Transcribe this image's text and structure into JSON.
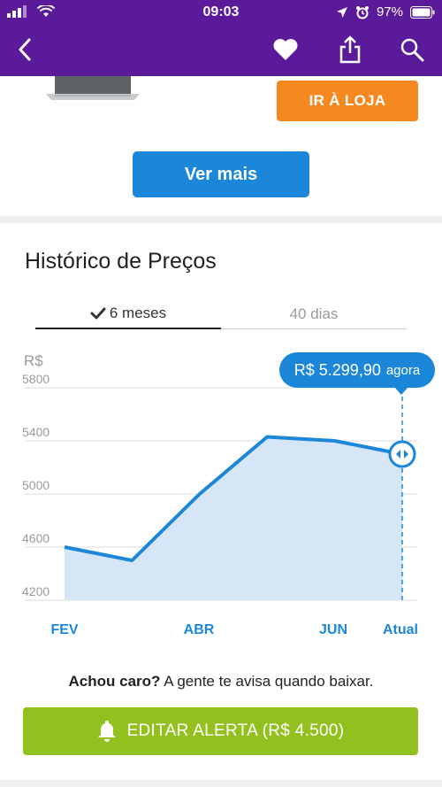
{
  "status_bar": {
    "time": "09:03",
    "battery": "97%"
  },
  "navbar": {
    "icons": [
      "back-icon",
      "heart-icon",
      "share-icon",
      "search-icon"
    ]
  },
  "product": {
    "store_button": "IR À LOJA",
    "more_button": "Ver mais"
  },
  "price_history": {
    "title": "Histórico de Preços",
    "tabs": [
      {
        "label": "6 meses",
        "active": true
      },
      {
        "label": "40 dias",
        "active": false
      }
    ],
    "current_price": "R$ 5.299,90",
    "current_suffix": "agora"
  },
  "chart_data": {
    "type": "area",
    "ylabel": "R$",
    "ylim": [
      4200,
      5800
    ],
    "yticks": [
      4200,
      4600,
      5000,
      5400,
      5800
    ],
    "xticks": [
      "FEV",
      "ABR",
      "JUN",
      "Atual"
    ],
    "x": [
      "FEV",
      "",
      "ABR",
      "",
      "JUN",
      "Atual"
    ],
    "values": [
      4600,
      4500,
      5000,
      5430,
      5400,
      5300
    ],
    "grid": true,
    "colors": {
      "line": "#1c87d8",
      "fill": "#d6e6f6",
      "label": "#1c87d8",
      "tick": "#999999"
    }
  },
  "alert": {
    "question": "Achou caro?",
    "text": " A gente te avisa quando baixar.",
    "button_label": "EDITAR ALERTA (R$ 4.500)"
  },
  "colors": {
    "brand": "#5b1a99",
    "store": "#f5891f",
    "primary": "#1c87d8",
    "alert": "#92c01f"
  }
}
